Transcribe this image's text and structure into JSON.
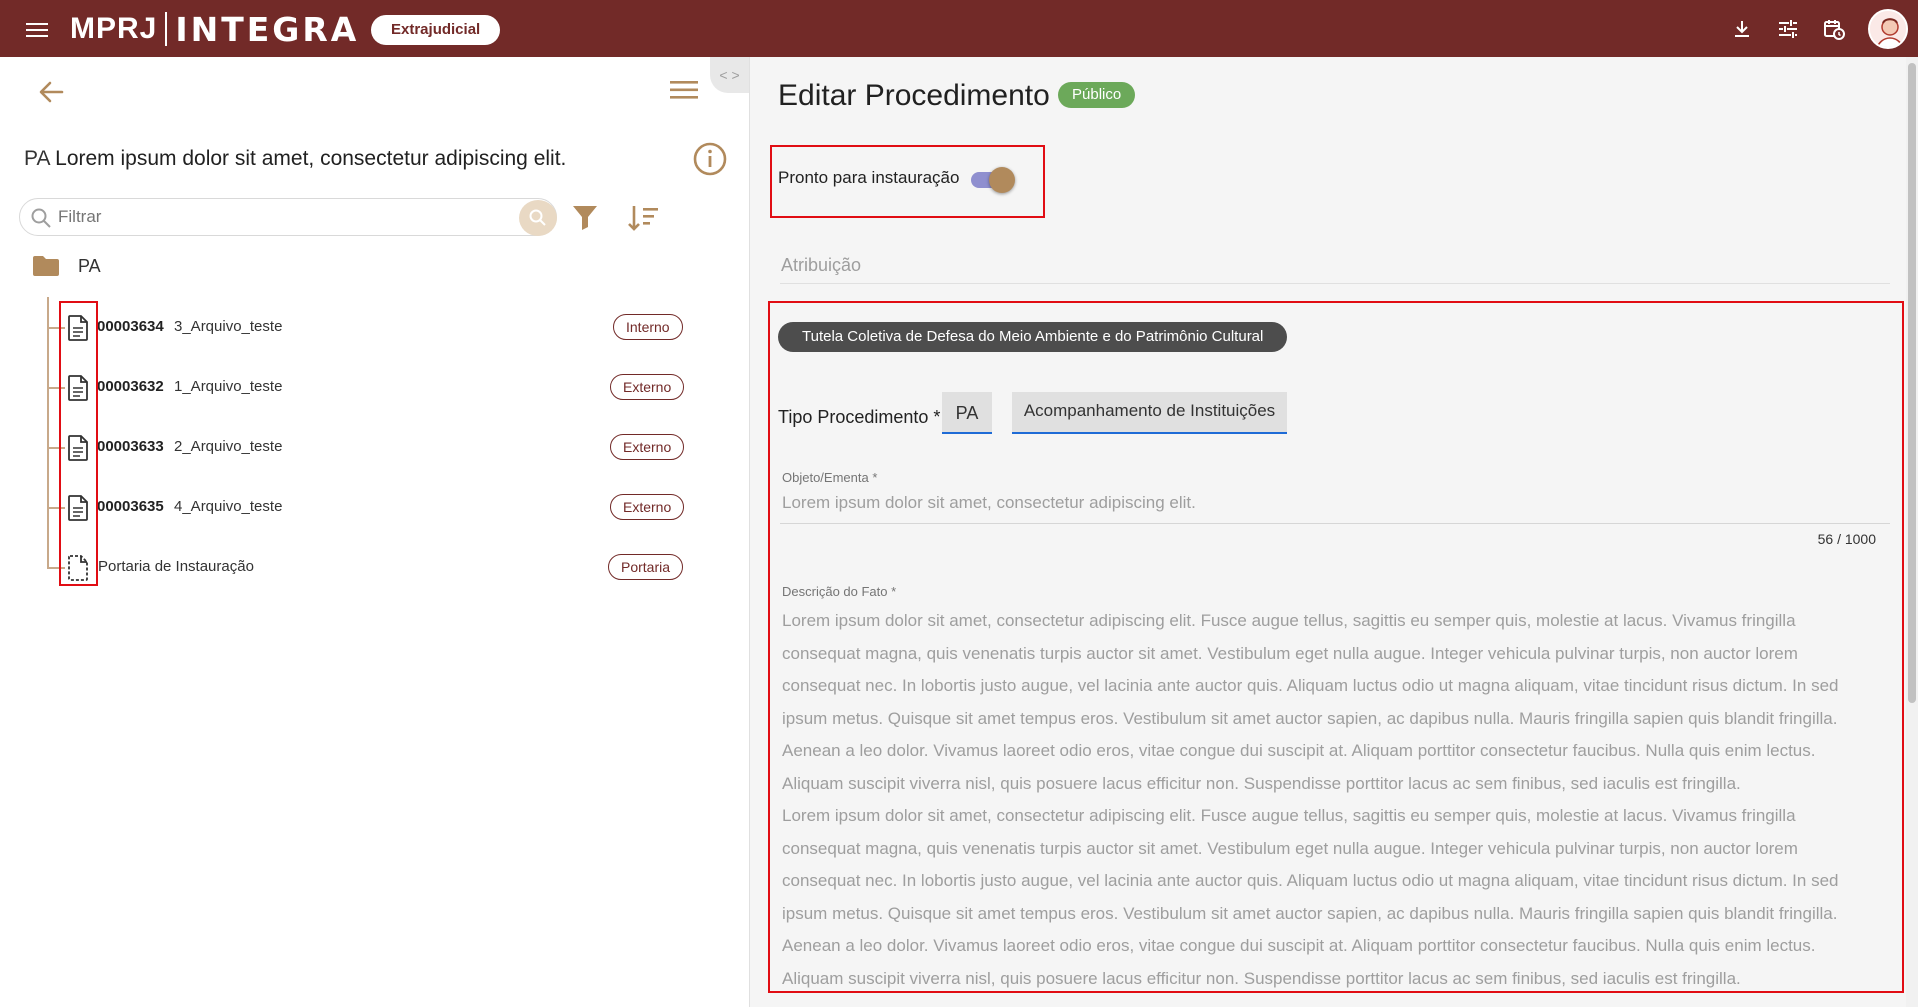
{
  "header": {
    "brand_left": "MPRJ",
    "brand_right": "INTEGRA",
    "context_pill": "Extrajudicial",
    "icons": [
      "download-icon",
      "tune-icon",
      "calendar-clock-icon"
    ],
    "colors": {
      "bar": "#722a28",
      "accent": "#b18a5c"
    }
  },
  "left_panel": {
    "collapse_handle": "< >",
    "title_prefix": "PA",
    "title": "Lorem ipsum dolor sit amet, consectetur adipiscing elit.",
    "filter_placeholder": "Filtrar",
    "folder_label": "PA",
    "files": [
      {
        "number": "00003634",
        "name": "3_Arquivo_teste",
        "tag": "Interno"
      },
      {
        "number": "00003632",
        "name": "1_Arquivo_teste",
        "tag": "Externo"
      },
      {
        "number": "00003633",
        "name": "2_Arquivo_teste",
        "tag": "Externo"
      },
      {
        "number": "00003635",
        "name": "4_Arquivo_teste",
        "tag": "Externo"
      },
      {
        "number": "",
        "name": "Portaria de Instauração",
        "tag": "Portaria"
      }
    ]
  },
  "form": {
    "page_title": "Editar Procedimento",
    "visibility_badge": "Público",
    "toggle_label": "Pronto para instauração",
    "toggle_on": true,
    "attribution_label": "Atribuição",
    "area_chip": "Tutela Coletiva de Defesa do Meio Ambiente e do Patrimônio Cultural",
    "tipo_label": "Tipo Procedimento *",
    "tipo_short": "PA",
    "tipo_value": "Acompanhamento de Instituições",
    "objeto_label": "Objeto/Ementa *",
    "objeto_value": "Lorem ipsum dolor sit amet, consectetur adipiscing elit.",
    "objeto_counter": "56 / 1000",
    "descricao_label": "Descrição do Fato *",
    "descricao_lines": [
      "Lorem ipsum dolor sit amet, consectetur adipiscing elit. Fusce augue tellus, sagittis eu semper quis, molestie at lacus. Vivamus fringilla",
      "consequat magna, quis venenatis turpis auctor sit amet. Vestibulum eget nulla augue. Integer vehicula pulvinar turpis, non auctor lorem",
      "consequat nec. In lobortis justo augue, vel lacinia ante auctor quis. Aliquam luctus odio ut magna aliquam, vitae tincidunt risus dictum. In sed",
      "ipsum metus. Quisque sit amet tempus eros. Vestibulum sit amet auctor sapien, ac dapibus nulla. Mauris fringilla sapien quis blandit fringilla.",
      "Aenean a leo dolor. Vivamus laoreet odio eros, vitae congue dui suscipit at. Aliquam porttitor consectetur faucibus. Nulla quis enim lectus.",
      "Aliquam suscipit viverra nisl, quis posuere lacus efficitur non. Suspendisse porttitor lacus ac sem finibus, sed iaculis est fringilla.",
      "Lorem ipsum dolor sit amet, consectetur adipiscing elit. Fusce augue tellus, sagittis eu semper quis, molestie at lacus. Vivamus fringilla",
      "consequat magna, quis venenatis turpis auctor sit amet. Vestibulum eget nulla augue. Integer vehicula pulvinar turpis, non auctor lorem",
      "consequat nec. In lobortis justo augue, vel lacinia ante auctor quis. Aliquam luctus odio ut magna aliquam, vitae tincidunt risus dictum. In sed",
      "ipsum metus. Quisque sit amet tempus eros. Vestibulum sit amet auctor sapien, ac dapibus nulla. Mauris fringilla sapien quis blandit fringilla.",
      "Aenean a leo dolor. Vivamus laoreet odio eros, vitae congue dui suscipit at. Aliquam porttitor consectetur faucibus. Nulla quis enim lectus.",
      "Aliquam suscipit viverra nisl, quis posuere lacus efficitur non. Suspendisse porttitor lacus ac sem finibus, sed iaculis est fringilla."
    ]
  }
}
